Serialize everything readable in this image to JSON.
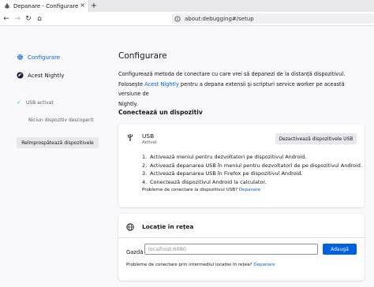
{
  "browser": {
    "tab_title": "Depanare - Configurare",
    "tab_close": "×",
    "new_tab": "+",
    "url": "about:debugging#/setup",
    "nav": {
      "back": "←",
      "forward": "→",
      "reload": "↻",
      "home": "⌂"
    }
  },
  "sidebar": {
    "items": [
      {
        "label": "Configurare",
        "icon": "gear-icon"
      },
      {
        "label": "Acest Nightly",
        "icon": "nightly-icon"
      }
    ],
    "usb_status": "USB activat",
    "no_device": "Niciun dispozitiv descoperit",
    "refresh_button": "Reîmprospătează dispozitivele"
  },
  "main": {
    "title": "Configurare",
    "intro_line1": "Configurează metoda de conectare cu care vrei să depanezi de la distanță dispozitivul.",
    "intro_line2_pre": "Folosește ",
    "intro_link": "Acest Nightly",
    "intro_line2_post": " pentru a depana extensii și scripturi service worker pe această versiune de",
    "intro_line3": "Nightly.",
    "connect_heading": "Conectează un dispozitiv",
    "usb": {
      "name": "USB",
      "status": "Activat",
      "disable_button": "Dezactivează dispozitivele USB",
      "steps": [
        {
          "num": "1.",
          "text": "Activează meniul pentru dezvoltatori pe dispozitivul Android."
        },
        {
          "num": "2.",
          "text": "Activează depanarea USB în meniul pentru dezvoltatori de pe dispozitivul Android."
        },
        {
          "num": "3.",
          "text": "Activează depanarea USB în Firefox pe dispozitivul Android."
        },
        {
          "num": "4.",
          "text": "Conectează dispozitivul Android la calculator."
        }
      ],
      "help_text": "Probleme de conectare la dispozitivul USB? ",
      "help_link": "Depanare"
    },
    "network": {
      "title": "Locație în rețea",
      "host_label": "Gazdă",
      "host_placeholder": "localhost:6080",
      "host_value": "",
      "add_button": "Adaugă",
      "help_text": "Probleme de conectare prin intermediul locației în rețea? ",
      "help_link": "Depanare"
    }
  },
  "colors": {
    "accent": "#0061e0",
    "check": "#2ac3a2",
    "page_bg": "#f9f9fb"
  }
}
